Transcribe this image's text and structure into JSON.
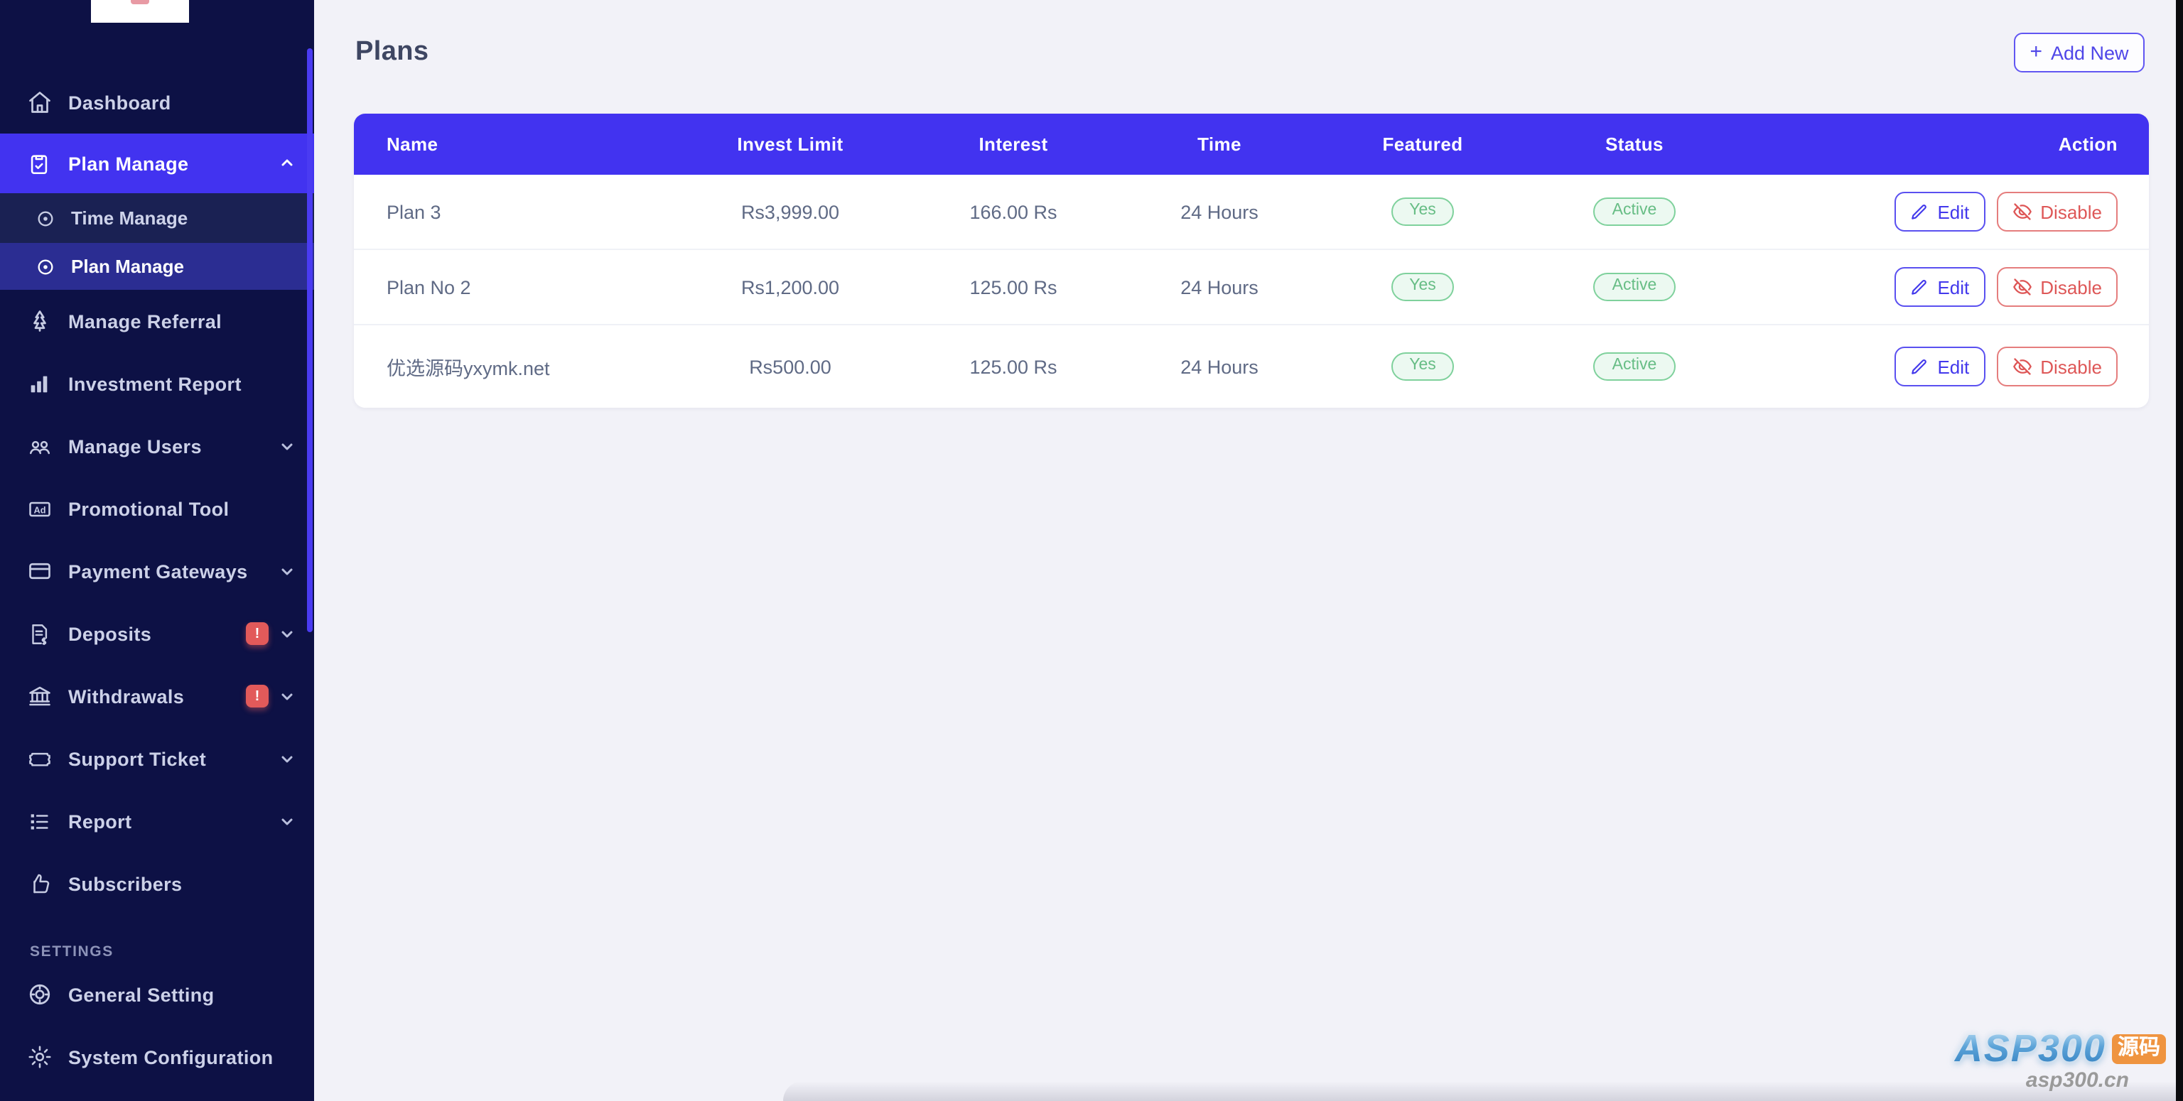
{
  "sidebar": {
    "items": [
      {
        "label": "Dashboard",
        "icon": "home"
      },
      {
        "label": "Plan Manage",
        "icon": "clipboard-check",
        "expanded": true,
        "children": [
          {
            "label": "Time Manage"
          },
          {
            "label": "Plan Manage",
            "active": true
          }
        ]
      },
      {
        "label": "Manage Referral",
        "icon": "referral-tree"
      },
      {
        "label": "Investment Report",
        "icon": "bar-chart"
      },
      {
        "label": "Manage Users",
        "icon": "users",
        "chevron": "down"
      },
      {
        "label": "Promotional Tool",
        "icon": "ad"
      },
      {
        "label": "Payment Gateways",
        "icon": "credit-card",
        "chevron": "down"
      },
      {
        "label": "Deposits",
        "icon": "file-invoice",
        "chevron": "down",
        "badge": "!"
      },
      {
        "label": "Withdrawals",
        "icon": "bank",
        "chevron": "down",
        "badge": "!"
      },
      {
        "label": "Support Ticket",
        "icon": "ticket",
        "chevron": "down"
      },
      {
        "label": "Report",
        "icon": "report-list",
        "chevron": "down"
      },
      {
        "label": "Subscribers",
        "icon": "thumbs-up"
      }
    ],
    "section_label": "SETTINGS",
    "settings_items": [
      {
        "label": "General Setting",
        "icon": "life-ring"
      },
      {
        "label": "System Configuration",
        "icon": "gear"
      }
    ]
  },
  "page": {
    "title": "Plans",
    "add_new_label": "Add New",
    "add_new_plus": "+"
  },
  "table": {
    "columns": [
      "Name",
      "Invest Limit",
      "Interest",
      "Time",
      "Featured",
      "Status",
      "Action"
    ],
    "edit_label": "Edit",
    "disable_label": "Disable",
    "rows": [
      {
        "name": "Plan 3",
        "invest_limit": "Rs3,999.00",
        "interest": "166.00 Rs",
        "time": "24 Hours",
        "featured": "Yes",
        "status": "Active"
      },
      {
        "name": "Plan No 2",
        "invest_limit": "Rs1,200.00",
        "interest": "125.00 Rs",
        "time": "24 Hours",
        "featured": "Yes",
        "status": "Active"
      },
      {
        "name": "优选源码yxymk.net",
        "invest_limit": "Rs500.00",
        "interest": "125.00 Rs",
        "time": "24 Hours",
        "featured": "Yes",
        "status": "Active"
      }
    ]
  },
  "watermark": {
    "brand": "ASP300",
    "badge": "源码",
    "site": "asp300.cn"
  },
  "colors": {
    "accent": "#4233f0",
    "sidebar_bg": "#0d1145",
    "submenu_bg": "#1a2153",
    "submenu_active": "#2b2d92",
    "badge_green_text": "#67bd85",
    "badge_green_border": "#7fd19c",
    "danger": "#e25a5a",
    "edit_blue": "#4339ec"
  }
}
